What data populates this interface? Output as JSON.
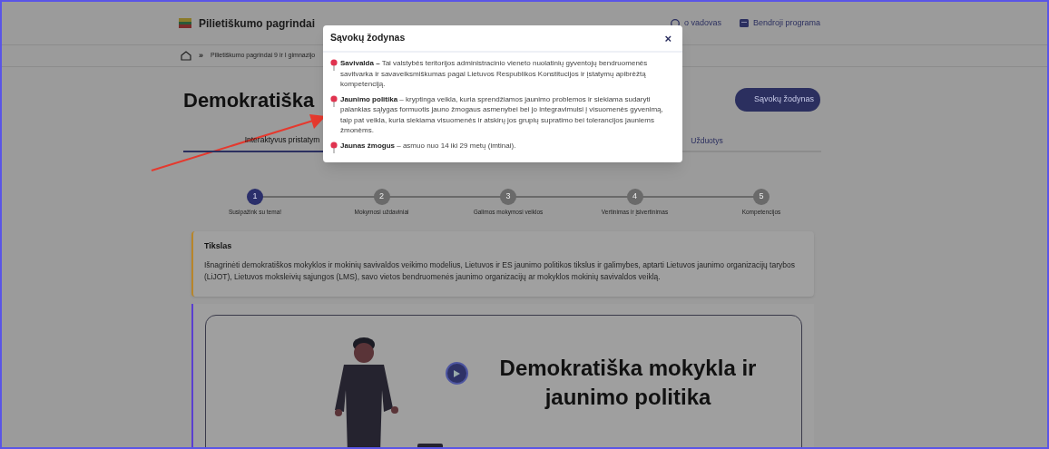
{
  "header": {
    "site_title": "Pilietiškumo pagrindai",
    "links": [
      {
        "kind": "user",
        "label": "o vadovas"
      },
      {
        "kind": "book",
        "label": "Bendroji programa"
      }
    ]
  },
  "breadcrumb": {
    "separator": "»",
    "items": [
      "Pilietiškumo pagrindai 9 ir I gimnazijo"
    ]
  },
  "page": {
    "title": "Demokratiška",
    "glossary_button": "Sąvokų žodynas"
  },
  "tabs": [
    {
      "label": "Interaktyvus pristatym",
      "selected": true
    },
    {
      "label": "Užduotys",
      "selected": false
    }
  ],
  "stepper": [
    {
      "number": "1",
      "label": "Susipažink su tema!",
      "selected": true
    },
    {
      "number": "2",
      "label": "Mokymosi uždaviniai",
      "selected": false
    },
    {
      "number": "3",
      "label": "Galimos mokymosi veiklos",
      "selected": false
    },
    {
      "number": "4",
      "label": "Vertinimas ir įsivertinimas",
      "selected": false
    },
    {
      "number": "5",
      "label": "Kompetencijos",
      "selected": false
    }
  ],
  "goal": {
    "title": "Tikslas",
    "text": "Išnagrinėti demokratiškos mokyklos ir mokinių savivaldos veikimo modelius, Lietuvos ir ES jaunimo politikos tikslus ir galimybes, aptarti Lietuvos jaunimo organizacijų tarybos (LiJOT), Lietuvos moksleivių sąjungos (LMS), savo vietos bendruomenės jaunimo organizacijų ar mokyklos mokinių savivaldos veiklą."
  },
  "video": {
    "title": "Demokratiška mokykla ir jaunimo politika"
  },
  "modal": {
    "title": "Sąvokų žodynas",
    "close": "×",
    "terms": [
      {
        "term": "Savivalda –",
        "definition": "Tai valstybės teritorijos administracinio vieneto nuolatinių gyventojų bendruomenės savitvarka ir savaveiksmiškumas pagal Lietuvos Respublikos Konstitucijos ir įstatymų apibrėžtą kompetenciją."
      },
      {
        "term": "Jaunimo politika",
        "definition": "– kryptinga veikla, kuria sprendžiamos jaunimo problemos ir siekiama sudaryti palankias sąlygas formuotis jauno žmogaus asmenybei bei jo integravimuisi į visuomenės gyvenimą, taip pat veikla, kuria siekiama visuomenės ir atskirų jos grupių supratimo bei tolerancijos jauniems žmonėms."
      },
      {
        "term": "Jaunas žmogus",
        "definition": "– asmuo nuo 14 iki 29 metų (imtinai)."
      }
    ]
  }
}
